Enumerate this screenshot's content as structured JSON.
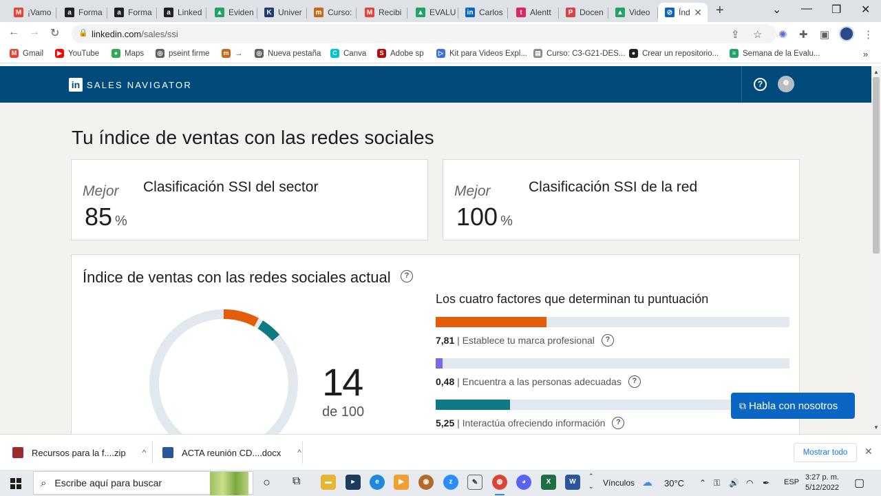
{
  "browser": {
    "tabs": [
      {
        "label": "¡Vamo",
        "color": "#ea4335",
        "glyph": "M"
      },
      {
        "label": "Forma",
        "color": "#202124",
        "glyph": "a"
      },
      {
        "label": "Forma",
        "color": "#202124",
        "glyph": "a"
      },
      {
        "label": "Linked",
        "color": "#202124",
        "glyph": "a"
      },
      {
        "label": "Eviden",
        "color": "#1fa463",
        "glyph": "▲"
      },
      {
        "label": "Univer",
        "color": "#1f3b73",
        "glyph": "K"
      },
      {
        "label": "Curso:",
        "color": "#c46a1a",
        "glyph": "m"
      },
      {
        "label": "Recibi",
        "color": "#ea4335",
        "glyph": "M"
      },
      {
        "label": "EVALU",
        "color": "#1fa463",
        "glyph": "▲"
      },
      {
        "label": "Carlos",
        "color": "#0a66c2",
        "glyph": "in"
      },
      {
        "label": "Alentt",
        "color": "#e0245e",
        "glyph": "t"
      },
      {
        "label": "Docen",
        "color": "#d64545",
        "glyph": "P"
      },
      {
        "label": "Video",
        "color": "#1fa463",
        "glyph": "▲"
      },
      {
        "label": "Índ",
        "color": "#0a66c2",
        "glyph": "⊘"
      }
    ],
    "url_host": "linkedin.com",
    "url_path": "/sales/ssi",
    "bookmarks": [
      {
        "label": "Gmail",
        "color": "#ea4335",
        "glyph": "M"
      },
      {
        "label": "YouTube",
        "color": "#ff0000",
        "glyph": "▶"
      },
      {
        "label": "Maps",
        "color": "#34a853",
        "glyph": "●"
      },
      {
        "label": "pseint firme",
        "color": "#5f6368",
        "glyph": "◎"
      },
      {
        "label": "→",
        "color": "#c46a1a",
        "glyph": "m"
      },
      {
        "label": "Nueva pestaña",
        "color": "#5f6368",
        "glyph": "◎"
      },
      {
        "label": "Canva",
        "color": "#00c4cc",
        "glyph": "C"
      },
      {
        "label": "Adobe sp",
        "color": "#b50a0a",
        "glyph": "S"
      },
      {
        "label": "Kit para Videos Expl...",
        "color": "#3d6fd8",
        "glyph": "▷"
      },
      {
        "label": "Curso: C3-G21-DES...",
        "color": "#8a8a8a",
        "glyph": "▤"
      },
      {
        "label": "Crear un repositorio...",
        "color": "#202124",
        "glyph": "●"
      },
      {
        "label": "Semana de la Evalu...",
        "color": "#1fa463",
        "glyph": "≡"
      }
    ]
  },
  "header": {
    "brand_letters": "in",
    "title": "SALES NAVIGATOR",
    "help_glyph": "?"
  },
  "page": {
    "title": "Tu índice de ventas con las redes sociales"
  },
  "rankings": [
    {
      "prefix": "Mejor",
      "value": "85",
      "unit": "%",
      "label": "Clasificación SSI del sector"
    },
    {
      "prefix": "Mejor",
      "value": "100",
      "unit": "%",
      "label": "Clasificación SSI de la red"
    }
  ],
  "ssi": {
    "title": "Índice de ventas con las redes sociales actual",
    "score": "14",
    "score_of": "de 100",
    "factors_title": "Los cuatro factores que determinan tu puntuación",
    "factors": [
      {
        "value": "7,81",
        "label": "| Establece tu marca profesional",
        "fraction": 0.3124,
        "color": "#e35d0b"
      },
      {
        "value": "0,48",
        "label": "| Encuentra a las personas adecuadas",
        "fraction": 0.0192,
        "color": "#7b68ee"
      },
      {
        "value": "5,25",
        "label": "| Interactúa ofreciendo información",
        "fraction": 0.21,
        "color": "#0e7a83"
      }
    ]
  },
  "chat": {
    "label": "Habla con nosotros"
  },
  "downloads": {
    "items": [
      {
        "name": "Recursos para la f....zip",
        "color": "#9b2d30"
      },
      {
        "name": "ACTA reunión CD....docx",
        "color": "#2b579a"
      }
    ],
    "show_all": "Mostrar todo"
  },
  "taskbar": {
    "search_placeholder": "Escribe aquí para buscar",
    "links_label": "Vínculos",
    "temperature": "30°C",
    "language": "ESP",
    "time": "3:27 p. m.",
    "date": "5/12/2022"
  }
}
